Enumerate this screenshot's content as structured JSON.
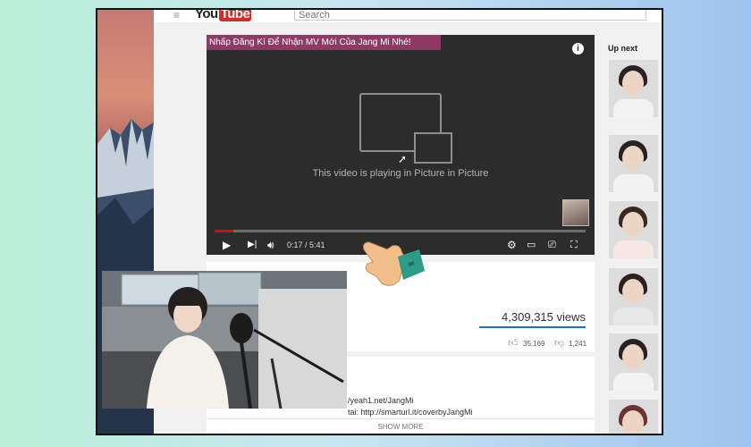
{
  "header": {
    "logo_text": "You",
    "logo_tube": "Tube",
    "menu_icon": "hamburger-menu-icon",
    "search_placeholder": "Search"
  },
  "player": {
    "banner": "Nhấp Đăng Kí Để Nhận MV Mới Của Jang Mi Nhé!",
    "info_icon": "info-icon",
    "pip_message": "This video is playing in Picture in Picture",
    "current_time": "0:17",
    "duration": "5:41",
    "time_display": "0:17 / 5:41",
    "progress_fraction": 0.05,
    "progress_color": "#ee0000",
    "banner_color": "#8e3a63"
  },
  "sidebar": {
    "up_next_title": "Up next",
    "thumbnails": 6
  },
  "video_meta": {
    "views": "4,309,315 views",
    "likes": "35,169",
    "dislikes": "1,241"
  },
  "description": {
    "line1": "/yeah1.net/JangMi",
    "line2": "tai: http://smarturl.it/coverbyJangMi",
    "show_more": "SHOW MORE"
  },
  "accent_colors": {
    "youtube_red": "#d62b26",
    "views_bar": "#1e6fcf",
    "hand_cuff": "#2e9a88"
  }
}
